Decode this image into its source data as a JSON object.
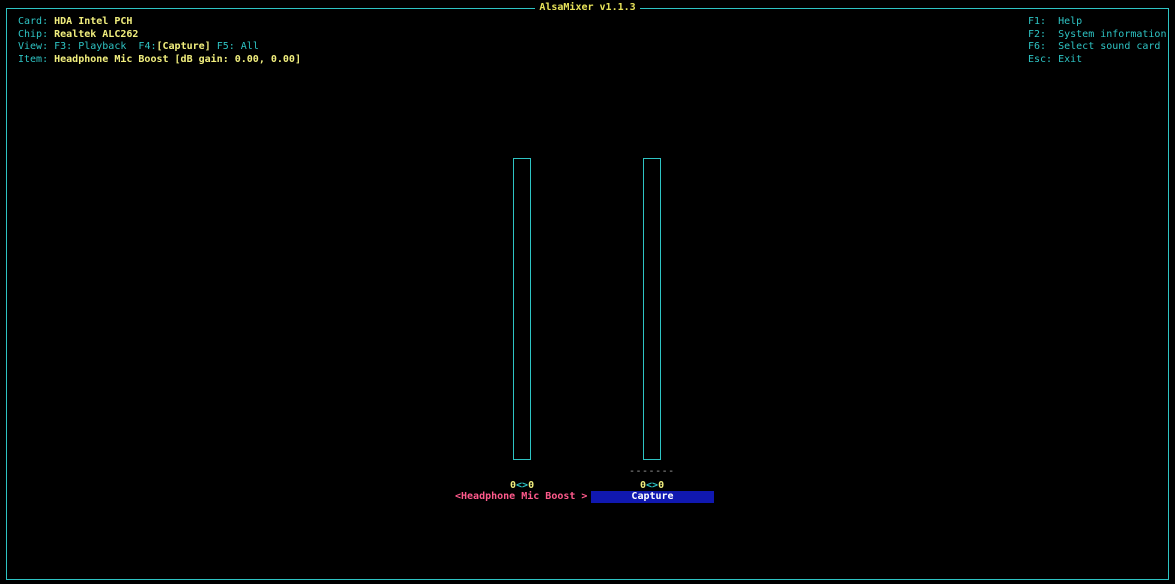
{
  "window": {
    "title": "AlsaMixer v1.1.3"
  },
  "info": {
    "card_label": "Card: ",
    "card_value": "HDA Intel PCH",
    "chip_label": "Chip: ",
    "chip_value": "Realtek ALC262",
    "view_label": "View: ",
    "view_playback": "F3: Playback",
    "view_capture_key": "F4:",
    "view_capture": "[Capture]",
    "view_all": "F5: All",
    "item_label": "Item: ",
    "item_value": "Headphone Mic Boost [dB gain: 0.00, 0.00]"
  },
  "keys": [
    "F1:  Help",
    "F2:  System information",
    "F6:  Select sound card",
    "Esc: Exit"
  ],
  "controls": [
    {
      "name": "Headphone Mic Boost",
      "left": "0",
      "sep": "<>",
      "right": "0",
      "display": "<Headphone Mic Boost >",
      "level": 0
    },
    {
      "name": "Capture",
      "left": "0",
      "sep": "<>",
      "right": "0",
      "display": "Capture",
      "dashes": "-------",
      "level": 0
    }
  ],
  "colors": {
    "accent": "#2ec4c4",
    "value": "#f2ef7e",
    "selected_label": "#ff5a8c",
    "capture_bg": "#1018b0"
  }
}
